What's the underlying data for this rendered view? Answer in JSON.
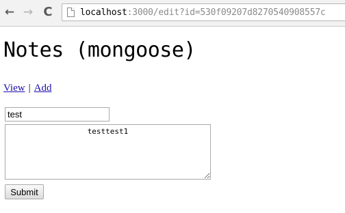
{
  "browser": {
    "back_icon": "←",
    "forward_icon": "→",
    "reload_icon": "C",
    "url_host": "localhost",
    "url_rest": ":3000/edit?id=530f09207d8270540908557c"
  },
  "page": {
    "title": "Notes (mongoose)",
    "nav": {
      "view_label": "View",
      "separator": "|",
      "add_label": "Add"
    }
  },
  "form": {
    "title_value": "test",
    "body_value": "testtest1",
    "submit_label": "Submit"
  }
}
